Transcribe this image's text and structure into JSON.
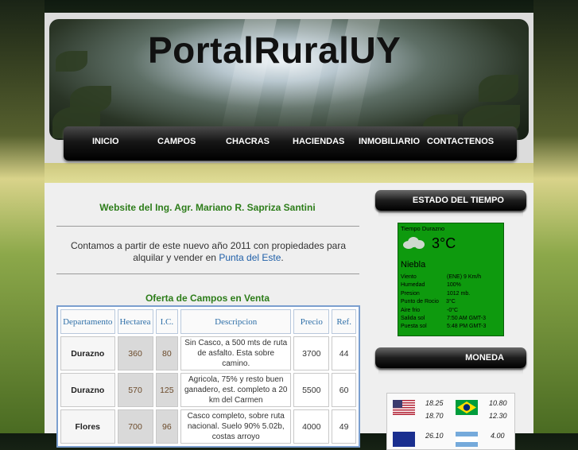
{
  "site": {
    "title": "PortalRuralUY"
  },
  "nav": {
    "items": [
      "INICIO",
      "CAMPOS",
      "CHACRAS",
      "HACIENDAS",
      "INMOBILIARIO",
      "CONTACTENOS"
    ]
  },
  "main": {
    "intro_title": "Website del Ing. Agr. Mariano R. Sapriza Santini",
    "intro_text": "Contamos a partir de este nuevo año 2011 con propiedades para alquilar y vender en",
    "intro_link": "Punta del Este",
    "intro_end": ".",
    "offer_title": "Oferta de Campos en Venta",
    "table": {
      "headers": [
        "Departamento",
        "Hectarea",
        "I.C.",
        "Descripcion",
        "Precio",
        "Ref."
      ],
      "rows": [
        {
          "departamento": "Durazno",
          "hectarea": "360",
          "ic": "80",
          "descripcion": "Sin Casco, a 500 mts de ruta de asfalto. Esta sobre camino.",
          "precio": "3700",
          "ref": "44"
        },
        {
          "departamento": "Durazno",
          "hectarea": "570",
          "ic": "125",
          "descripcion": "Agricola, 75% y resto buen ganadero, est. completo a 20 km del Carmen",
          "precio": "5500",
          "ref": "60"
        },
        {
          "departamento": "Flores",
          "hectarea": "700",
          "ic": "96",
          "descripcion": "Casco completo, sobre ruta nacional. Suelo 90% 5.02b, costas arroyo",
          "precio": "4000",
          "ref": "49"
        }
      ]
    }
  },
  "sidebar": {
    "weather_title": "ESTADO DEL TIEMPO",
    "weather": {
      "location": "Tiempo Durazno",
      "temperature": "3°C",
      "condition": "Niebla",
      "details": [
        {
          "label": "Viento",
          "value": "(ENE) 9 Km/h"
        },
        {
          "label": "Humedad",
          "value": "100%"
        },
        {
          "label": "Presion",
          "value": "1012 mb."
        },
        {
          "label": "Punto de Rocio",
          "value": "3°C"
        },
        {
          "label": "Aire frio",
          "value": "-0°C"
        },
        {
          "label": "Salida sol",
          "value": "7:50 AM GMT-3"
        },
        {
          "label": "Puesta sol",
          "value": "5:48 PM GMT-3"
        }
      ]
    },
    "currency_title": "MONEDA",
    "currency": {
      "usd": [
        "18.25",
        "18.70"
      ],
      "brl": [
        "10.80",
        "12.30"
      ],
      "eur_partial": "26.10",
      "ars_partial": "4.00"
    }
  }
}
